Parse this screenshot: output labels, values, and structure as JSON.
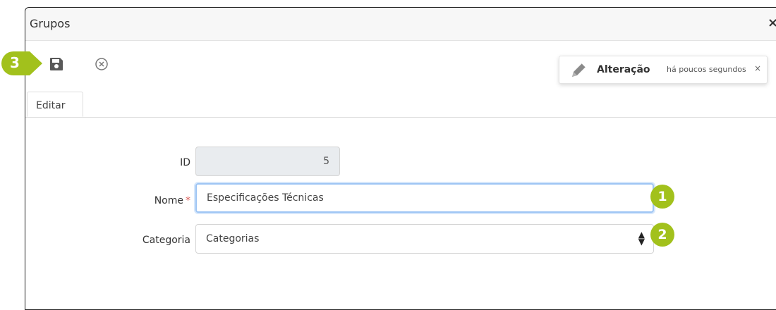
{
  "window": {
    "title": "Grupos",
    "close_label": "×"
  },
  "toolbar": {
    "save_icon": "save-icon",
    "cancel_icon": "circle-x-icon"
  },
  "tabs": [
    {
      "label": "Editar",
      "active": true
    }
  ],
  "form": {
    "id": {
      "label": "ID",
      "value": "5"
    },
    "nome": {
      "label": "Nome",
      "required_mark": "*",
      "value": "Especificações Técnicas"
    },
    "categoria": {
      "label": "Categoria",
      "value": "Categorias",
      "arrows": "⬍"
    }
  },
  "notification": {
    "icon": "pencil-icon",
    "title": "Alteração",
    "time": "há poucos segundos",
    "close_label": "×"
  },
  "callouts": [
    {
      "number": "1"
    },
    {
      "number": "2"
    },
    {
      "number": "3"
    }
  ],
  "colors": {
    "callout_green": "#a2c11c",
    "focus_border": "#9ec5f4",
    "required_red": "#d9534f",
    "disabled_field_bg": "#e9ecef"
  }
}
